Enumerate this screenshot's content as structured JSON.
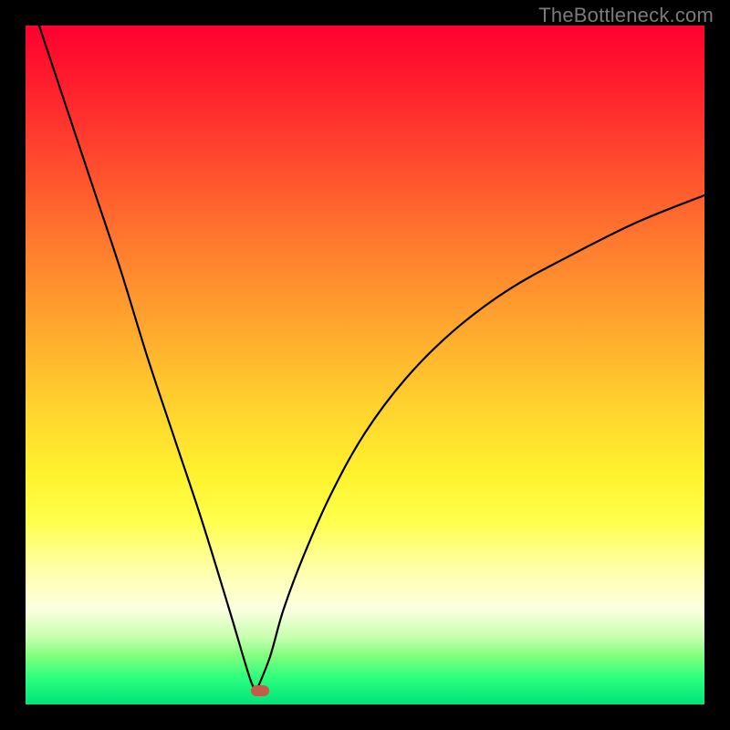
{
  "watermark": "TheBottleneck.com",
  "colors": {
    "frame_bg": "#000000",
    "watermark_text": "#7a7a7a",
    "curve_stroke": "#000000",
    "marker_fill": "#c85a4a",
    "gradient_stops": [
      {
        "pos": 0.0,
        "color": "#ff0030"
      },
      {
        "pos": 0.08,
        "color": "#ff1c2d"
      },
      {
        "pos": 0.2,
        "color": "#ff4a2e"
      },
      {
        "pos": 0.32,
        "color": "#ff7a2e"
      },
      {
        "pos": 0.44,
        "color": "#ffa62e"
      },
      {
        "pos": 0.56,
        "color": "#ffd22e"
      },
      {
        "pos": 0.66,
        "color": "#fff22e"
      },
      {
        "pos": 0.73,
        "color": "#ffff4c"
      },
      {
        "pos": 0.8,
        "color": "#ffffa8"
      },
      {
        "pos": 0.86,
        "color": "#fcffe0"
      },
      {
        "pos": 0.9,
        "color": "#c8ffb0"
      },
      {
        "pos": 0.93,
        "color": "#7dff7d"
      },
      {
        "pos": 0.96,
        "color": "#2dff7d"
      },
      {
        "pos": 1.0,
        "color": "#00e37a"
      }
    ]
  },
  "chart_data": {
    "type": "line",
    "title": "",
    "xlabel": "",
    "ylabel": "",
    "xlim": [
      0,
      100
    ],
    "ylim": [
      0,
      100
    ],
    "notes": "V-shaped bottleneck curve. Minimum (valley) near x≈34, y≈2. Left branch starts at top-left corner (x≈2, y=100) descending steeply and nearly linearly to the valley. Right branch rises from the valley with decreasing slope, reaching y≈75 at x=100. A small rounded red marker sits at the valley floor.",
    "series": [
      {
        "name": "left-branch",
        "x": [
          2,
          6,
          10,
          14,
          18,
          22,
          26,
          30,
          33,
          34
        ],
        "y": [
          100,
          88,
          76,
          64,
          51,
          39,
          27,
          14,
          4,
          2
        ]
      },
      {
        "name": "right-branch",
        "x": [
          34,
          36,
          38,
          41,
          45,
          50,
          56,
          63,
          71,
          80,
          90,
          100
        ],
        "y": [
          2,
          7,
          14,
          22,
          31,
          40,
          48,
          55,
          61,
          66,
          71,
          75
        ]
      }
    ],
    "marker": {
      "x": 34.5,
      "y": 2
    }
  }
}
